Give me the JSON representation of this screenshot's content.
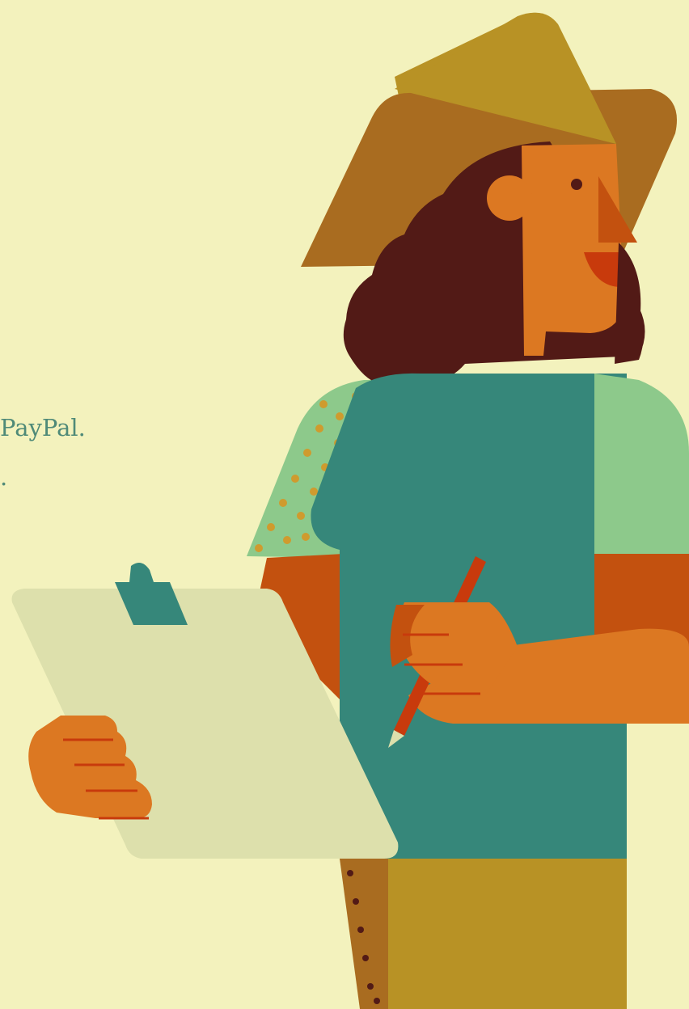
{
  "caption": {
    "line1": "PayPal.",
    "line2": "."
  },
  "colors": {
    "background": "#f3f2bd",
    "caption_text": "#4f8a78",
    "hat_front": "#a96c20",
    "hat_back": "#b89225",
    "skin": "#dc7822",
    "hair": "#521a16",
    "shirt_teal": "#36877a",
    "shirt_green": "#8dc98b",
    "sleeve_orange": "#c3510f",
    "clipboard": "#dde0ac",
    "pencil": "#c83a0c",
    "pants": "#b89225"
  }
}
